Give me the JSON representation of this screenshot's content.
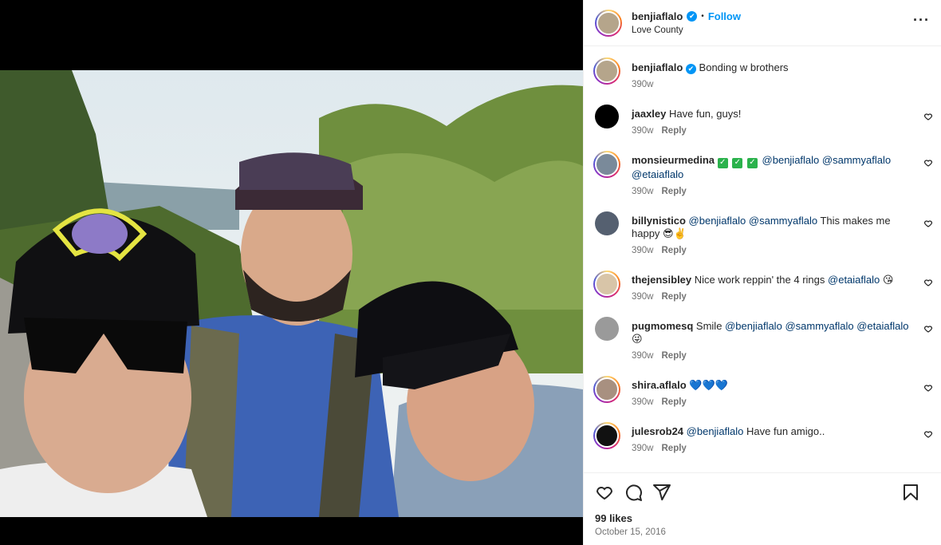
{
  "post": {
    "username": "benjiaflalo",
    "verified_badge": "✔",
    "separator": "•",
    "follow_label": "Follow",
    "location": "Love County",
    "more_label": "···",
    "caption": "Bonding w brothers",
    "caption_time": "390w",
    "likes": "99 likes",
    "date": "October 15, 2016"
  },
  "comments": [
    {
      "user": "jaaxley",
      "parts": [
        {
          "t": "Have fun, guys!"
        }
      ],
      "time": "390w",
      "reply": "Reply",
      "avatar": "#000000"
    },
    {
      "user": "monsieurmedina",
      "parts": [
        {
          "check": "✓"
        },
        {
          "check": "✓"
        },
        {
          "check": "✓"
        },
        {
          "m": "@benjiaflalo"
        },
        {
          "m": "@sammyaflalo"
        },
        {
          "m": "@etaiaflalo"
        }
      ],
      "time": "390w",
      "reply": "Reply",
      "avatar": "#7a8a9a"
    },
    {
      "user": "billynistico",
      "parts": [
        {
          "m": "@benjiaflalo"
        },
        {
          "m": "@sammyaflalo"
        },
        {
          "t": "This makes me happy 😎✌️"
        }
      ],
      "time": "390w",
      "reply": "Reply",
      "avatar": "#556070"
    },
    {
      "user": "thejensibley",
      "parts": [
        {
          "t": "Nice work reppin' the 4 rings"
        },
        {
          "m": "@etaiaflalo"
        },
        {
          "t": "😘"
        }
      ],
      "time": "390w",
      "reply": "Reply",
      "avatar": "#d8c5a8"
    },
    {
      "user": "pugmomesq",
      "parts": [
        {
          "t": "Smile"
        },
        {
          "m": "@benjiaflalo"
        },
        {
          "m": "@sammyaflalo"
        },
        {
          "m": "@etaiaflalo"
        },
        {
          "t": "😜"
        }
      ],
      "time": "390w",
      "reply": "Reply",
      "avatar": "#9a9a9a"
    },
    {
      "user": "shira.aflalo",
      "parts": [
        {
          "t": "💙💙💙"
        }
      ],
      "time": "390w",
      "reply": "Reply",
      "avatar": "#a89080"
    },
    {
      "user": "julesrob24",
      "parts": [
        {
          "m": "@benjiaflalo"
        },
        {
          "t": "Have fun amigo.."
        }
      ],
      "time": "390w",
      "reply": "Reply",
      "avatar": "#111111"
    }
  ],
  "icons": {
    "like": "heart-icon",
    "comment": "comment-icon",
    "share": "share-icon",
    "save": "bookmark-icon"
  },
  "colors": {
    "accent": "#0095f6",
    "mention": "#00376b",
    "muted": "#737373"
  }
}
